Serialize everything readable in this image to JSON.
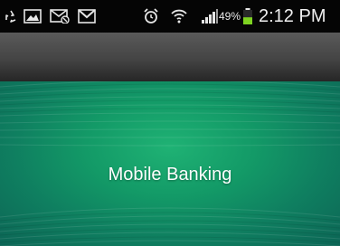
{
  "status_bar": {
    "battery_percent": "49%",
    "time": "2:12 PM",
    "left_icons": [
      "recycle-icon",
      "gallery-icon",
      "mail-muted-icon",
      "gmail-icon"
    ],
    "right_icons": [
      "alarm-icon",
      "wifi-icon",
      "signal-icon",
      "battery-icon"
    ],
    "battery_level": 0.49,
    "battery_color": "#7ed321"
  },
  "banner": {
    "title": "Mobile Banking",
    "colors": [
      "#1fb274",
      "#0f7f60",
      "#0c6555"
    ]
  },
  "action_bar": {
    "color": "#444444"
  }
}
